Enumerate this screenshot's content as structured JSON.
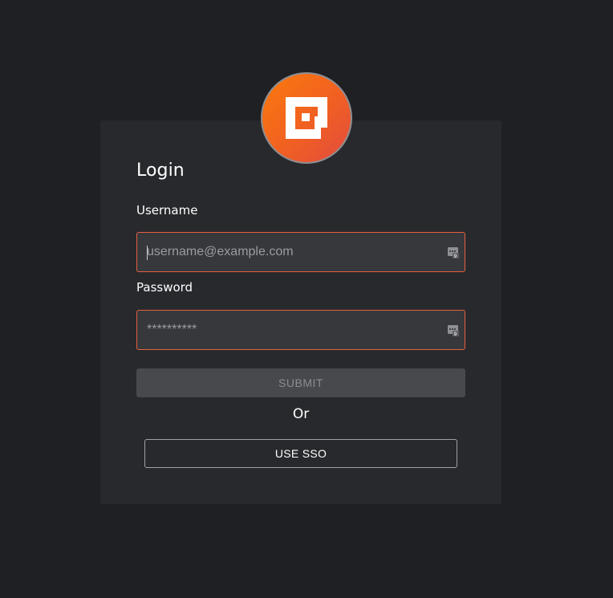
{
  "logo": {
    "icon": "brand-logo-icon",
    "colors": [
      "#fb7a0c",
      "#e24b3f"
    ]
  },
  "form": {
    "title": "Login",
    "username": {
      "label": "Username",
      "placeholder": "username@example.com",
      "value": ""
    },
    "password": {
      "label": "Password",
      "placeholder": "**********",
      "value": ""
    },
    "submit_label": "SUBMIT",
    "divider_text": "Or",
    "sso_label": "USE SSO"
  },
  "icons": {
    "field_icon": "password-manager-icon"
  },
  "colors": {
    "page_background": "#1f2023",
    "card_background": "#28292d",
    "field_border_error": "#e5603f",
    "submit_disabled": "#47494d"
  }
}
